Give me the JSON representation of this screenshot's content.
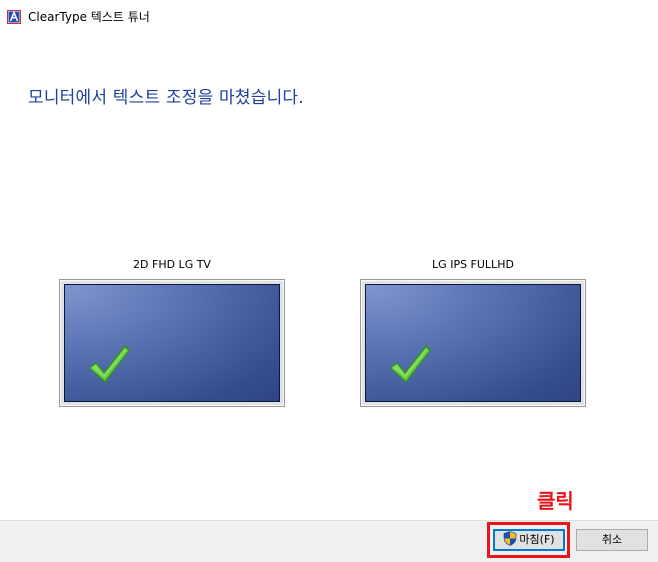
{
  "window": {
    "title": "ClearType 텍스트 튜너",
    "app_icon": "cleartype-app-icon"
  },
  "main": {
    "heading": "모니터에서 텍스트 조정을 마쳤습니다.",
    "monitors": [
      {
        "label": "2D FHD LG TV",
        "status_icon": "checkmark-icon"
      },
      {
        "label": "LG IPS FULLHD",
        "status_icon": "checkmark-icon"
      }
    ]
  },
  "annotation": {
    "text": "클릭",
    "color": "#e8151b"
  },
  "footer": {
    "finish_label": "마침(F)",
    "finish_icon": "uac-shield-icon",
    "cancel_label": "취소"
  },
  "colors": {
    "heading": "#1f3f99",
    "screen": "#3a5193",
    "check": "#4cb52a",
    "focus": "#0078d7"
  }
}
